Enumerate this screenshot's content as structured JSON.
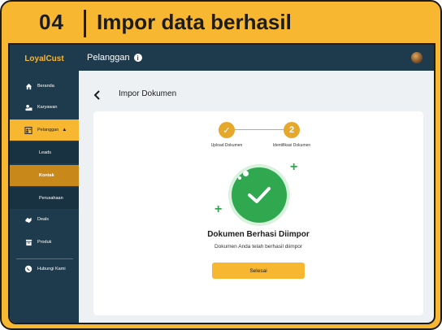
{
  "banner": {
    "step_number": "04",
    "title": "Impor data berhasil"
  },
  "app": {
    "brand": "LoyalCust",
    "topbar": {
      "title": "Pelanggan",
      "info_icon": "info-icon",
      "avatar": "user-avatar"
    },
    "sidebar": {
      "items": [
        {
          "label": "Beranda",
          "icon": "home-icon"
        },
        {
          "label": "Karyawan",
          "icon": "employees-icon"
        },
        {
          "label": "Pelanggan",
          "icon": "customers-icon",
          "active": true,
          "expanded": true
        },
        {
          "label": "Leads",
          "sub": true
        },
        {
          "label": "Kontak",
          "sub": true,
          "active": true
        },
        {
          "label": "Perusahaan",
          "sub": true
        },
        {
          "label": "Deals",
          "icon": "deals-icon"
        },
        {
          "label": "Produk",
          "icon": "product-icon"
        },
        {
          "label": "Hubungi Kami",
          "icon": "whatsapp-icon"
        }
      ]
    },
    "page_title": "Impor Dokumen",
    "stepper": {
      "steps": [
        {
          "label": "Upload Dokumen",
          "state": "done",
          "marker": "✓"
        },
        {
          "label": "Identifikasi Dokumen",
          "state": "current",
          "marker": "2"
        }
      ]
    },
    "result": {
      "title": "Dokumen Berhasi Diimpor",
      "message": "Dokumen Anda telah berhasil diimpor",
      "button_label": "Selesai"
    }
  },
  "colors": {
    "accent": "#f7b731",
    "sidebar": "#1d3b4d",
    "success": "#2fa84f"
  }
}
